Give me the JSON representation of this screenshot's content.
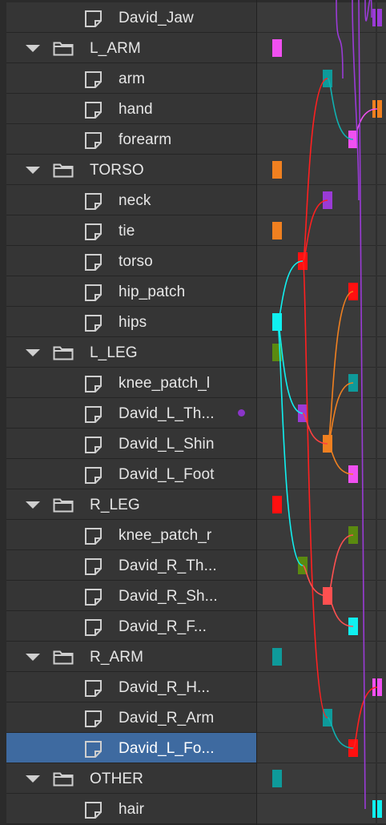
{
  "layers": [
    {
      "type": "layer",
      "label": "David_Jaw",
      "color": "#9a3bd6"
    },
    {
      "type": "group",
      "label": "L_ARM",
      "color": "#f050f0"
    },
    {
      "type": "layer",
      "label": "arm",
      "color": "#0e9a9a"
    },
    {
      "type": "layer",
      "label": "hand",
      "color": "#f08020"
    },
    {
      "type": "layer",
      "label": "forearm",
      "color": "#f050f0"
    },
    {
      "type": "group",
      "label": "TORSO",
      "color": "#f08020"
    },
    {
      "type": "layer",
      "label": "neck",
      "color": "#9a3bd6"
    },
    {
      "type": "layer",
      "label": "tie",
      "color": "#f08020"
    },
    {
      "type": "layer",
      "label": "torso",
      "color": "#ff1010"
    },
    {
      "type": "layer",
      "label": "hip_patch",
      "color": "#ff1010"
    },
    {
      "type": "layer",
      "label": "hips",
      "color": "#10f0f0"
    },
    {
      "type": "group",
      "label": "L_LEG",
      "color": "#5a8a10"
    },
    {
      "type": "layer",
      "label": "knee_patch_l",
      "color": "#0e9a9a"
    },
    {
      "type": "layer",
      "label": "David_L_Th...",
      "color": "#9a3bd6",
      "marker": true
    },
    {
      "type": "layer",
      "label": "David_L_Shin",
      "color": "#f08020"
    },
    {
      "type": "layer",
      "label": "David_L_Foot",
      "color": "#f050f0"
    },
    {
      "type": "group",
      "label": "R_LEG",
      "color": "#ff1010"
    },
    {
      "type": "layer",
      "label": "knee_patch_r",
      "color": "#5a8a10"
    },
    {
      "type": "layer",
      "label": "David_R_Th...",
      "color": "#5a8a10"
    },
    {
      "type": "layer",
      "label": "David_R_Sh...",
      "color": "#ff5050"
    },
    {
      "type": "layer",
      "label": "David_R_F...",
      "color": "#10f0f0"
    },
    {
      "type": "group",
      "label": "R_ARM",
      "color": "#0e9a9a"
    },
    {
      "type": "layer",
      "label": "David_R_H...",
      "color": "#f050f0"
    },
    {
      "type": "layer",
      "label": "David_R_Arm",
      "color": "#0e9a9a"
    },
    {
      "type": "layer",
      "label": "David_L_Fo...",
      "color": "#ff1010",
      "selected": true
    },
    {
      "type": "group",
      "label": "OTHER",
      "color": "#0e9a9a"
    },
    {
      "type": "layer",
      "label": "hair",
      "color": "#10f0f0"
    }
  ]
}
